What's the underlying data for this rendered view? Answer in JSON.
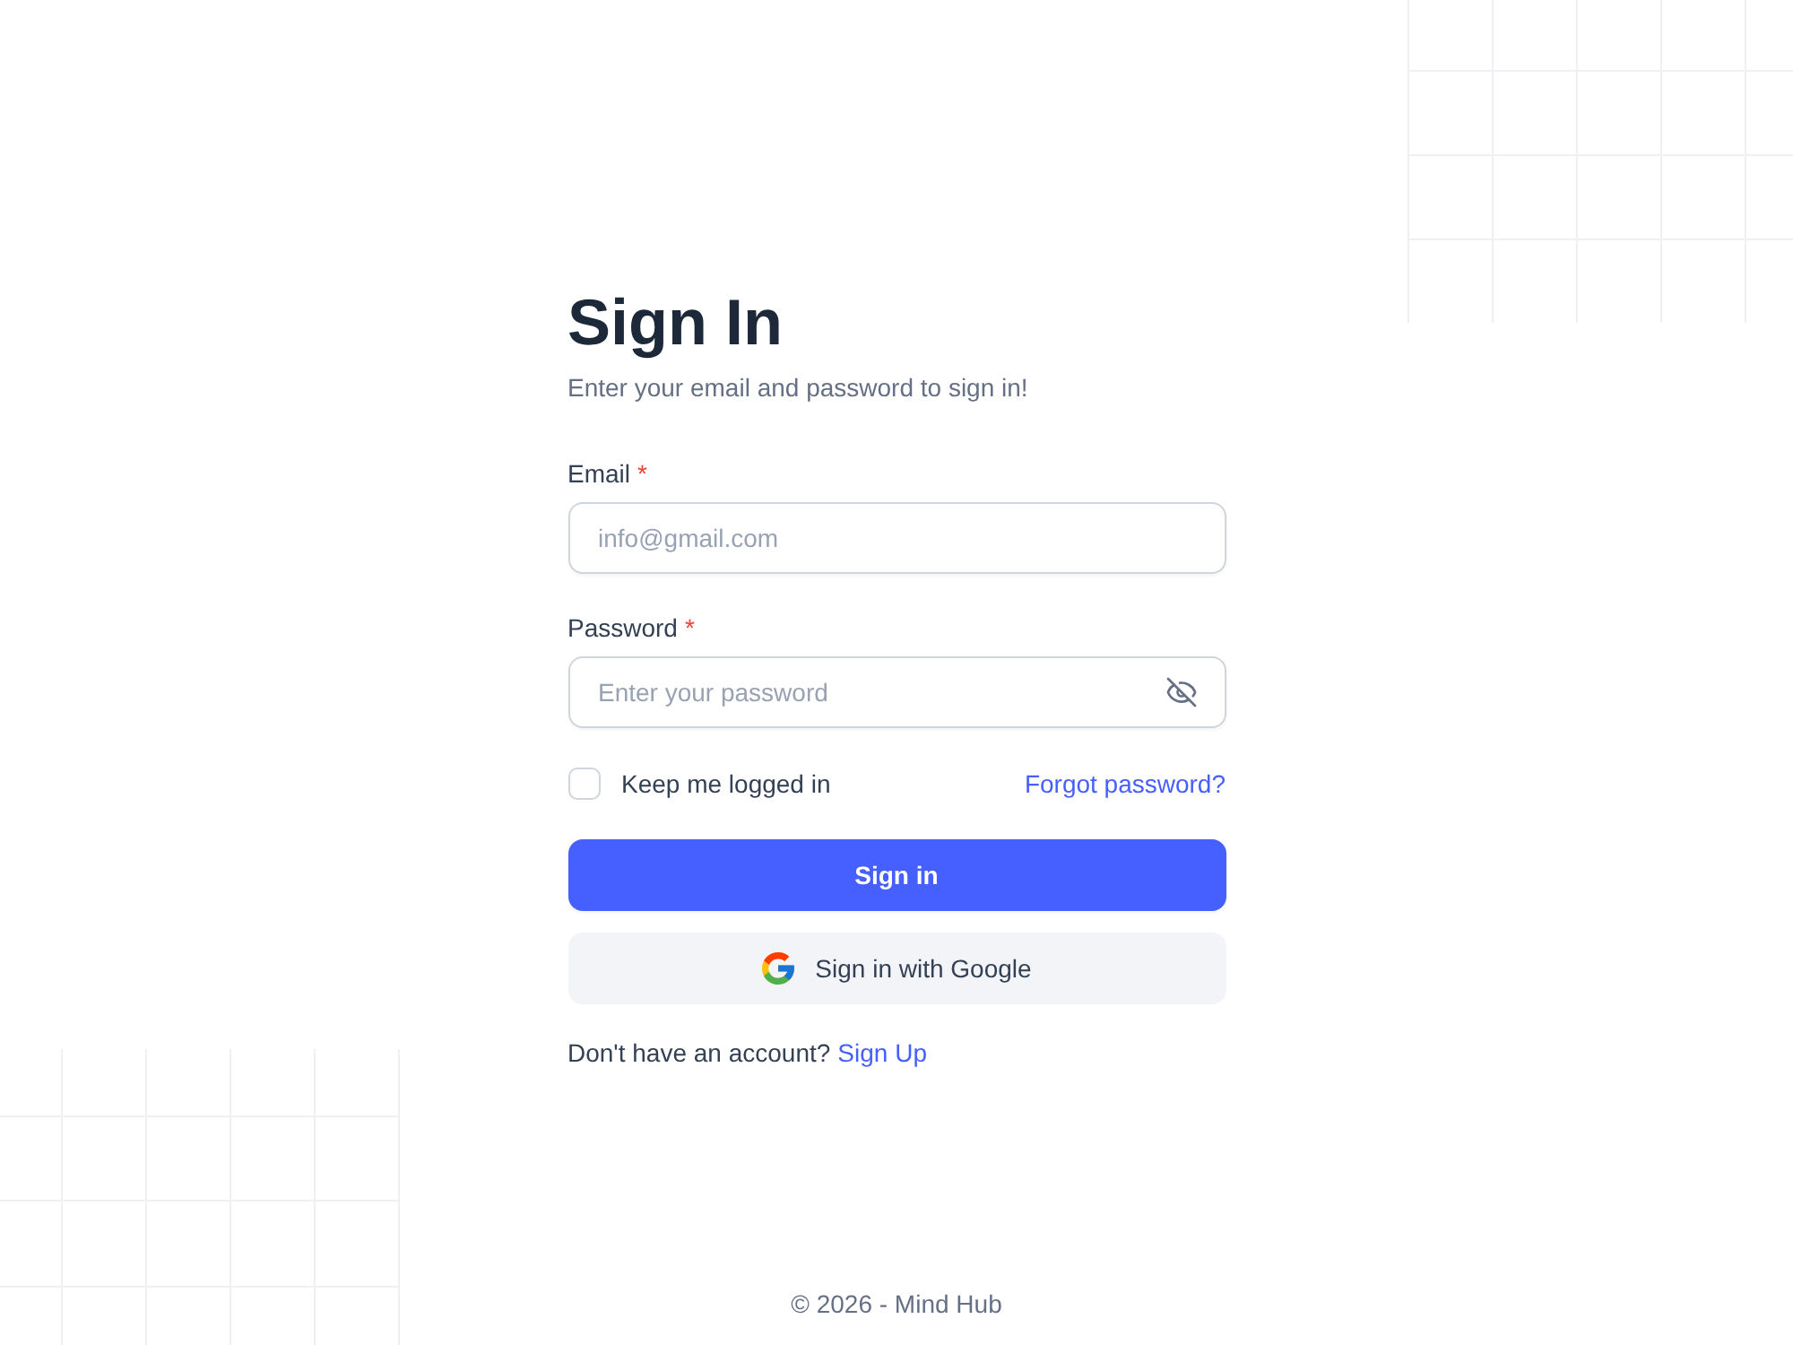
{
  "title": "Sign In",
  "subtitle": "Enter your email and password to sign in!",
  "fields": [
    {
      "kind": "email",
      "label": "Email",
      "required_mark": "*",
      "placeholder": "info@gmail.com"
    },
    {
      "kind": "password",
      "label": "Password",
      "required_mark": "*",
      "placeholder": "Enter your password"
    }
  ],
  "remember": {
    "label": "Keep me logged in",
    "checked": false
  },
  "forgot_link": "Forgot password?",
  "primary_button": "Sign in",
  "google_button": "Sign in with Google",
  "signup": {
    "prompt": "Don't have an account?",
    "link": "Sign Up"
  },
  "footer": "© 2026 - Mind Hub"
}
